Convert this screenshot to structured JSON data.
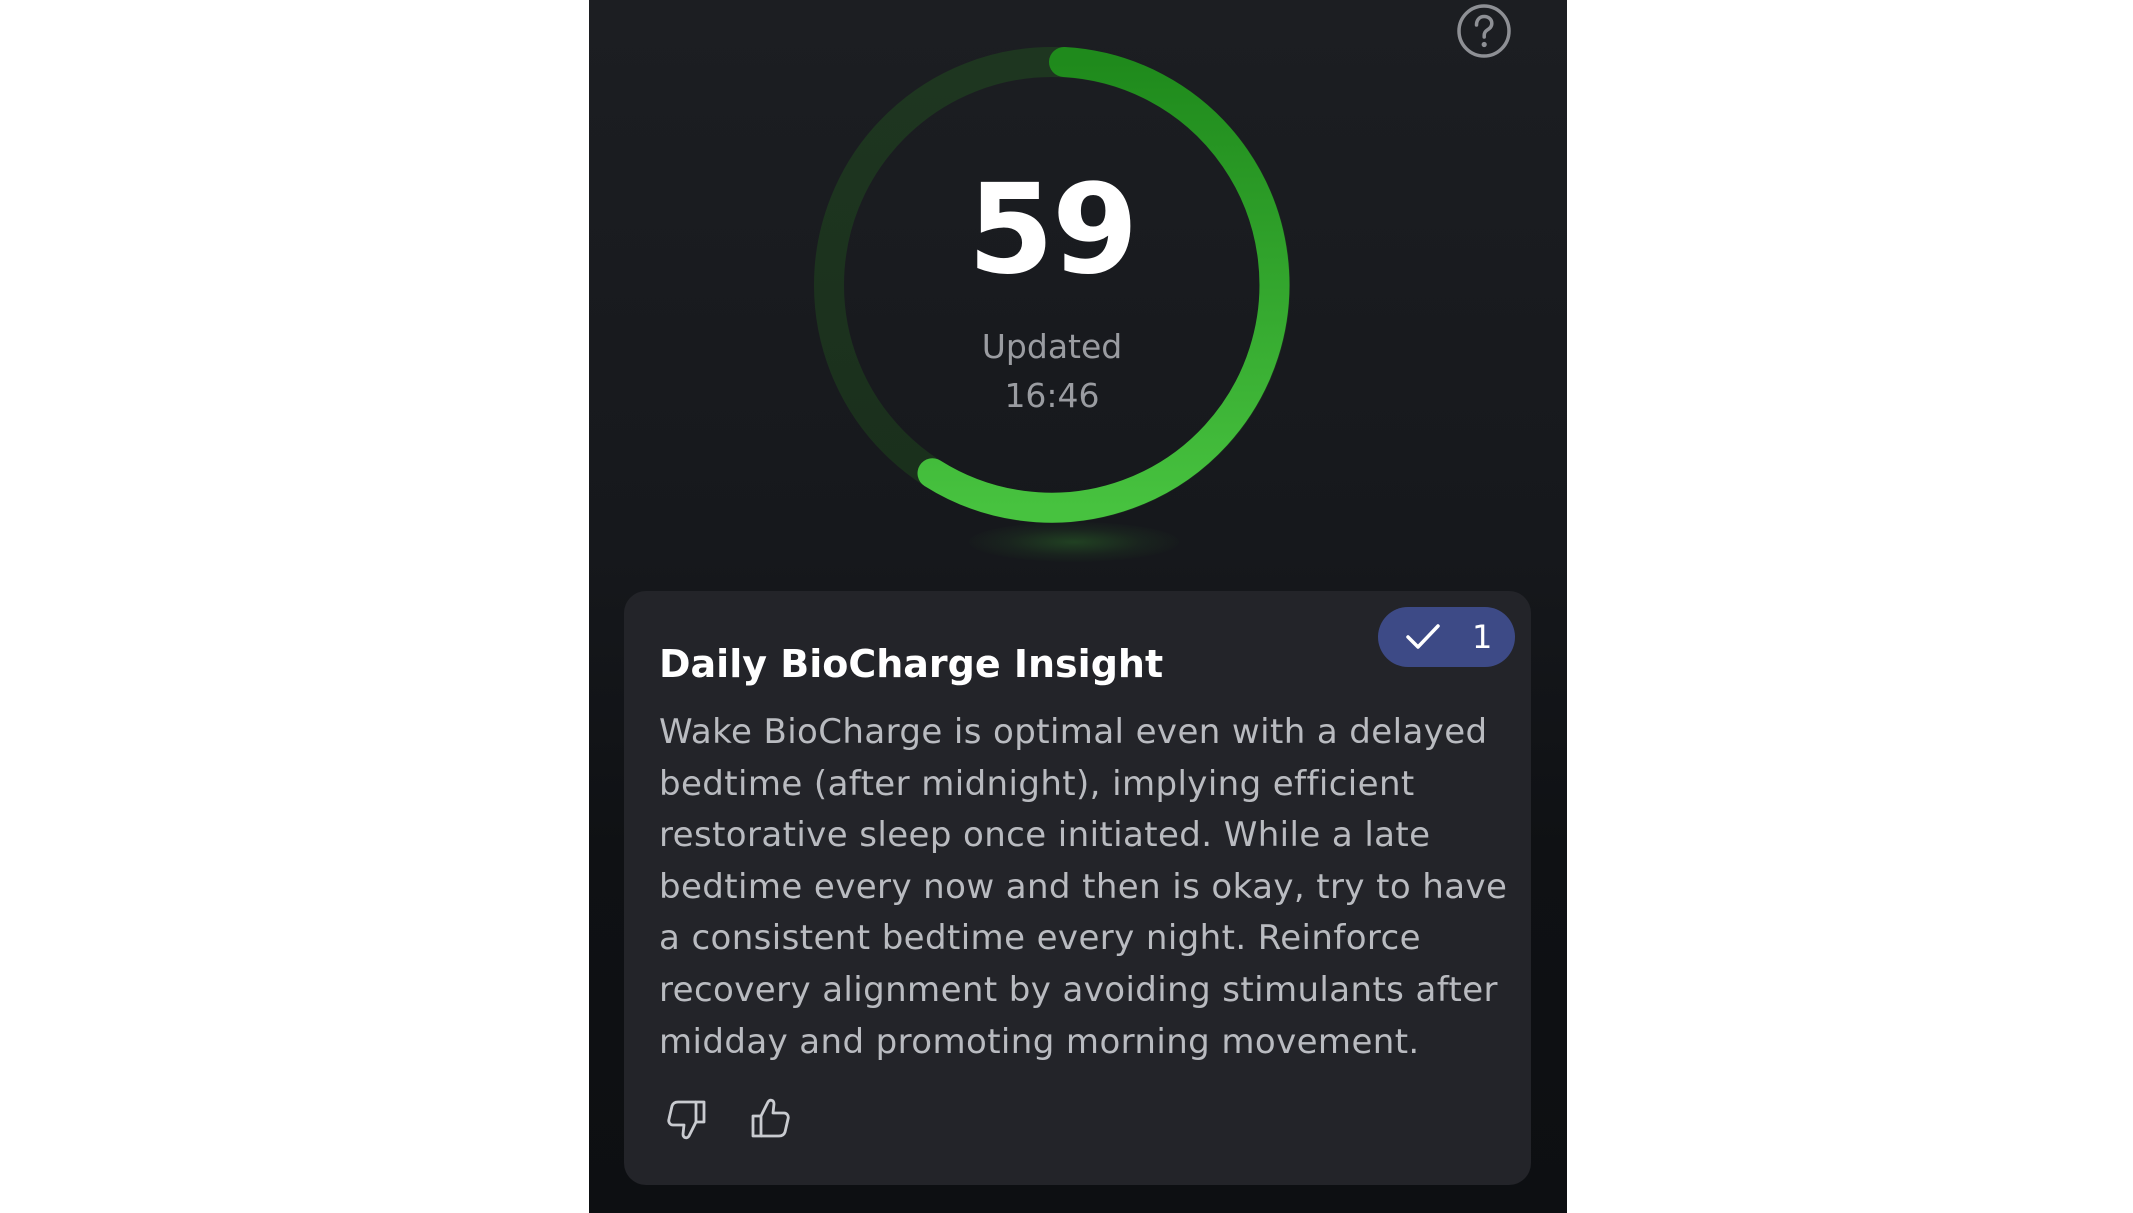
{
  "score": {
    "value": "59",
    "progress_fraction": 0.59,
    "updated_label": "Updated",
    "updated_time": "16:46"
  },
  "icons": {
    "help": "help-circle-icon",
    "check": "check-icon",
    "thumbs_down": "thumbs-down-icon",
    "thumbs_up": "thumbs-up-icon"
  },
  "insight": {
    "title": "Daily BioCharge Insight",
    "badge_count": "1",
    "body": "Wake BioCharge is optimal even with a delayed bedtime (after midnight), implying efficient restorative sleep once initiated. While a late bedtime every now and then is okay, try to have a consistent bedtime every night. Reinforce recovery alignment by avoiding stimulants after midday and promoting morning movement."
  },
  "colors": {
    "ring_progress_start": "#1f8a1c",
    "ring_progress_end": "#47c23f",
    "ring_track": "#1f3a22",
    "badge_bg": "#3d4a86",
    "card_bg": "#232429"
  }
}
